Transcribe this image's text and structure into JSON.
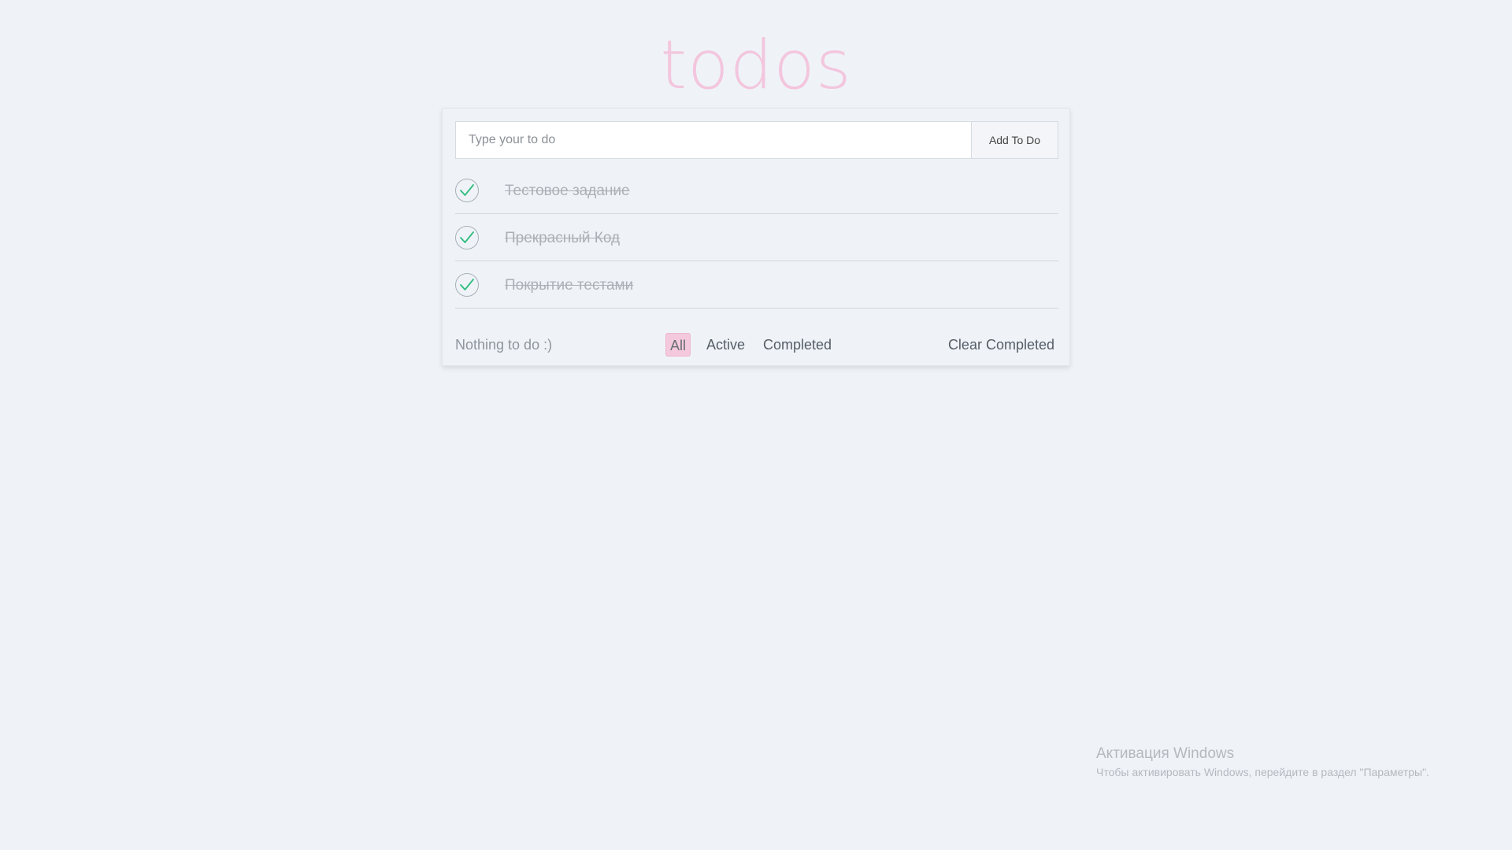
{
  "app": {
    "title": "todos"
  },
  "add_form": {
    "input_value": "",
    "input_placeholder": "Type your to do",
    "button_label": "Add To Do"
  },
  "todos": [
    {
      "text": "Тестовое задание",
      "completed": true
    },
    {
      "text": "Прекрасный Код",
      "completed": true
    },
    {
      "text": "Покрытие тестами",
      "completed": true
    }
  ],
  "footer": {
    "items_left": "Nothing to do :)",
    "filters": [
      {
        "label": "All",
        "selected": true
      },
      {
        "label": "Active",
        "selected": false
      },
      {
        "label": "Completed",
        "selected": false
      }
    ],
    "clear_label": "Clear Completed"
  },
  "watermark": {
    "title": "Активация Windows",
    "subtitle": "Чтобы активировать Windows, перейдите в раздел \"Параметры\"."
  },
  "icons": {
    "check": "checkmark-icon"
  },
  "colors": {
    "background": "#eff3f8",
    "title": "#f3c6de",
    "check_mark": "#2ebd7e",
    "selected_filter": "#f5c9dd",
    "completed_text": "#aab0b6"
  }
}
